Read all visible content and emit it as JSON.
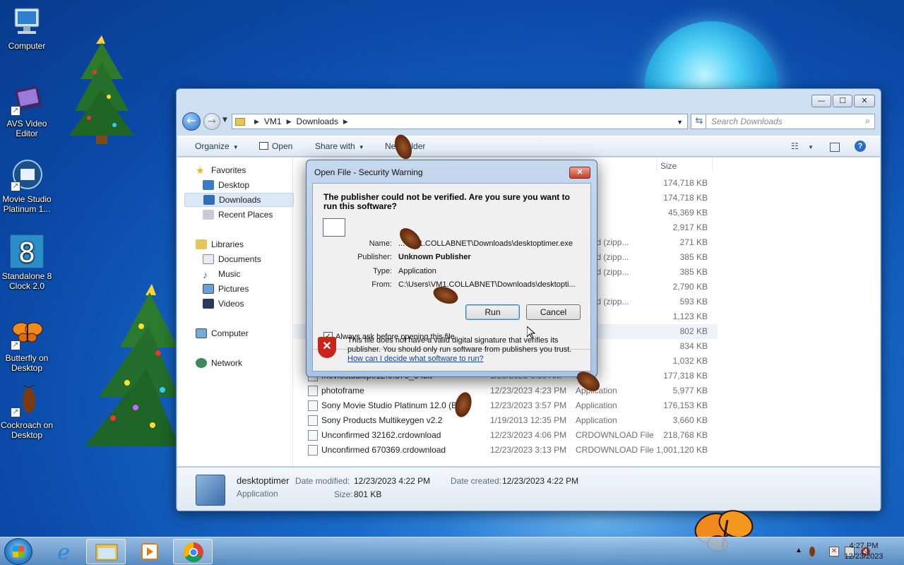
{
  "desktop_icons": [
    {
      "label": "Computer",
      "icon": "computer-icon"
    },
    {
      "label": "AVS Video Editor",
      "icon": "video-editor-icon"
    },
    {
      "label": "Movie Studio Platinum 1...",
      "icon": "movie-studio-icon"
    },
    {
      "label": "Standalone 8 Clock 2.0",
      "icon": "clock-8-icon"
    },
    {
      "label": "Butterfly on Desktop",
      "icon": "butterfly-icon"
    },
    {
      "label": "Cockroach on Desktop",
      "icon": "cockroach-icon"
    }
  ],
  "explorer": {
    "window_controls": {
      "minimize": "—",
      "maximize": "☐",
      "close": "✕"
    },
    "breadcrumb": [
      "VM1",
      "Downloads"
    ],
    "search_placeholder": "Search Downloads",
    "toolbar": {
      "organize": "Organize",
      "open": "Open",
      "share_with": "Share with",
      "new_folder": "New folder"
    },
    "nav_pane": {
      "favorites": "Favorites",
      "favorites_items": [
        "Desktop",
        "Downloads",
        "Recent Places"
      ],
      "libraries": "Libraries",
      "libraries_items": [
        "Documents",
        "Music",
        "Pictures",
        "Videos"
      ],
      "computer": "Computer",
      "network": "Network"
    },
    "columns": {
      "size": "Size"
    },
    "partial_rows": [
      {
        "type": "ation",
        "size": "174,718 KB"
      },
      {
        "type": "ation",
        "size": "174,718 KB"
      },
      {
        "type": "ation",
        "size": "45,369 KB"
      },
      {
        "type": "ation",
        "size": "2,917 KB"
      },
      {
        "type": "ressed (zipp...",
        "size": "271 KB"
      },
      {
        "type": "ressed (zipp...",
        "size": "385 KB"
      },
      {
        "type": "ressed (zipp...",
        "size": "385 KB"
      },
      {
        "type": "ation",
        "size": "2,790 KB"
      },
      {
        "type": "ressed (zipp...",
        "size": "593 KB"
      },
      {
        "type": "ation",
        "size": "1,123 KB"
      },
      {
        "type": "ation",
        "size": "802 KB"
      },
      {
        "type": "ation",
        "size": "834 KB"
      },
      {
        "type": "ation",
        "size": "1,032 KB"
      }
    ],
    "rows": [
      {
        "name": "moviestudiope12.0.376_64bit",
        "date": "1/29/2023 6:30 AM",
        "type": "ation",
        "size": "177,318 KB"
      },
      {
        "name": "photoframe",
        "date": "12/23/2023 4:23 PM",
        "type": "Application",
        "size": "5,977 KB"
      },
      {
        "name": "Sony Movie Studio Platinum 12.0 (B...",
        "date": "12/23/2023 3:57 PM",
        "type": "Application",
        "size": "176,153 KB"
      },
      {
        "name": "Sony Products Multikeygen v2.2",
        "date": "1/19/2013 12:35 PM",
        "type": "Application",
        "size": "3,660 KB"
      },
      {
        "name": "Unconfirmed 32162.crdownload",
        "date": "12/23/2023 4:06 PM",
        "type": "CRDOWNLOAD File",
        "size": "218,768 KB"
      },
      {
        "name": "Unconfirmed 670369.crdownload",
        "date": "12/23/2023 3:13 PM",
        "type": "CRDOWNLOAD File",
        "size": "1,001,120 KB"
      }
    ],
    "details": {
      "name": "desktoptimer",
      "type": "Application",
      "date_modified_label": "Date modified:",
      "date_modified": "12/23/2023 4:22 PM",
      "date_created_label": "Date created:",
      "date_created": "12/23/2023 4:22 PM",
      "size_label": "Size:",
      "size": "801 KB"
    }
  },
  "dialog": {
    "title": "Open File - Security Warning",
    "close": "✕",
    "question": "The publisher could not be verified.  Are you sure you want to run this software?",
    "name_label": "Name:",
    "name_value": "...\\VM1.COLLABNET\\Downloads\\desktoptimer.exe",
    "publisher_label": "Publisher:",
    "publisher_value": "Unknown Publisher",
    "type_label": "Type:",
    "type_value": "Application",
    "from_label": "From:",
    "from_value": "C:\\Users\\VM1.COLLABNET\\Downloads\\desktopti...",
    "run": "Run",
    "cancel": "Cancel",
    "checkbox_label": "Always ask before opening this file",
    "checkbox_checked": true,
    "warning": "This file does not have a valid digital signature that verifies its publisher.  You should only run software from publishers you trust.",
    "link": "How can I decide what software to run?"
  },
  "taskbar": {
    "apps": [
      "internet-explorer-icon",
      "windows-explorer-icon",
      "media-player-icon",
      "chrome-icon"
    ],
    "time": "4:27 PM",
    "date": "12/23/2023"
  }
}
